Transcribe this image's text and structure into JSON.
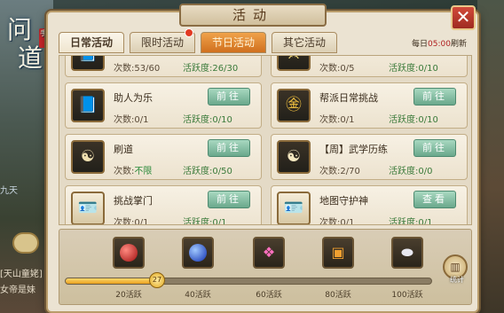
{
  "window": {
    "title": "活动",
    "close_icon": "close-icon",
    "accent": "#b02020"
  },
  "game": {
    "logo": "问\n道",
    "logo_badge": "手游",
    "chat_lines": [
      "九天",
      "[天山童姥]",
      "女帝是妹"
    ]
  },
  "tabs": [
    {
      "label": "日常活动",
      "active": true
    },
    {
      "label": "限时活动",
      "active": false
    },
    {
      "label": "节日活动",
      "active": false
    },
    {
      "label": "其它活动",
      "active": false
    }
  ],
  "refresh": {
    "prefix": "每日",
    "time": "05:00",
    "suffix": "刷新"
  },
  "activities": [
    {
      "name": "",
      "icon": "exp-book-icon",
      "count_label": "次数:53/60",
      "vitality": "活跃度:26/30",
      "button": ""
    },
    {
      "name": "",
      "icon": "crossed-swords-icon",
      "count_label": "次数:0/5",
      "vitality": "活跃度:0/10",
      "button": ""
    },
    {
      "name": "助人为乐",
      "icon": "exp-book-icon",
      "count_label": "次数:0/1",
      "vitality": "活跃度:0/10",
      "button": "前往"
    },
    {
      "name": "帮派日常挑战",
      "icon": "gong-coin-icon",
      "count_label": "次数:0/1",
      "vitality": "活跃度:0/10",
      "button": "前往"
    },
    {
      "name": "刷道",
      "icon": "taiji-scroll-icon",
      "count_label_prefix": "次数:",
      "count_label_value": "不限",
      "vitality": "活跃度:0/50",
      "button": "前往"
    },
    {
      "name": "【周】武学历练",
      "icon": "taiji-icon",
      "count_label": "次数:2/70",
      "vitality": "活跃度:0/0",
      "button": "前往"
    },
    {
      "name": "挑战掌门",
      "icon": "id-card-icon",
      "count_label": "次数:0/1",
      "vitality": "活跃度:0/1",
      "button": "前往"
    },
    {
      "name": "地图守护神",
      "icon": "id-card-icon",
      "count_label": "次数:0/1",
      "vitality": "活跃度:0/1",
      "button": "查看"
    }
  ],
  "rewards": {
    "current_points": "27",
    "progress_fraction": 0.2536,
    "milestones": [
      "20活跃",
      "40活跃",
      "60活跃",
      "80活跃",
      "100活跃"
    ],
    "chest_icons": [
      "red-orb-icon",
      "blue-orb-icon",
      "pink-gems-icon",
      "treasure-chest-icon",
      "silver-ingot-icon"
    ],
    "stats_label": "统计"
  }
}
